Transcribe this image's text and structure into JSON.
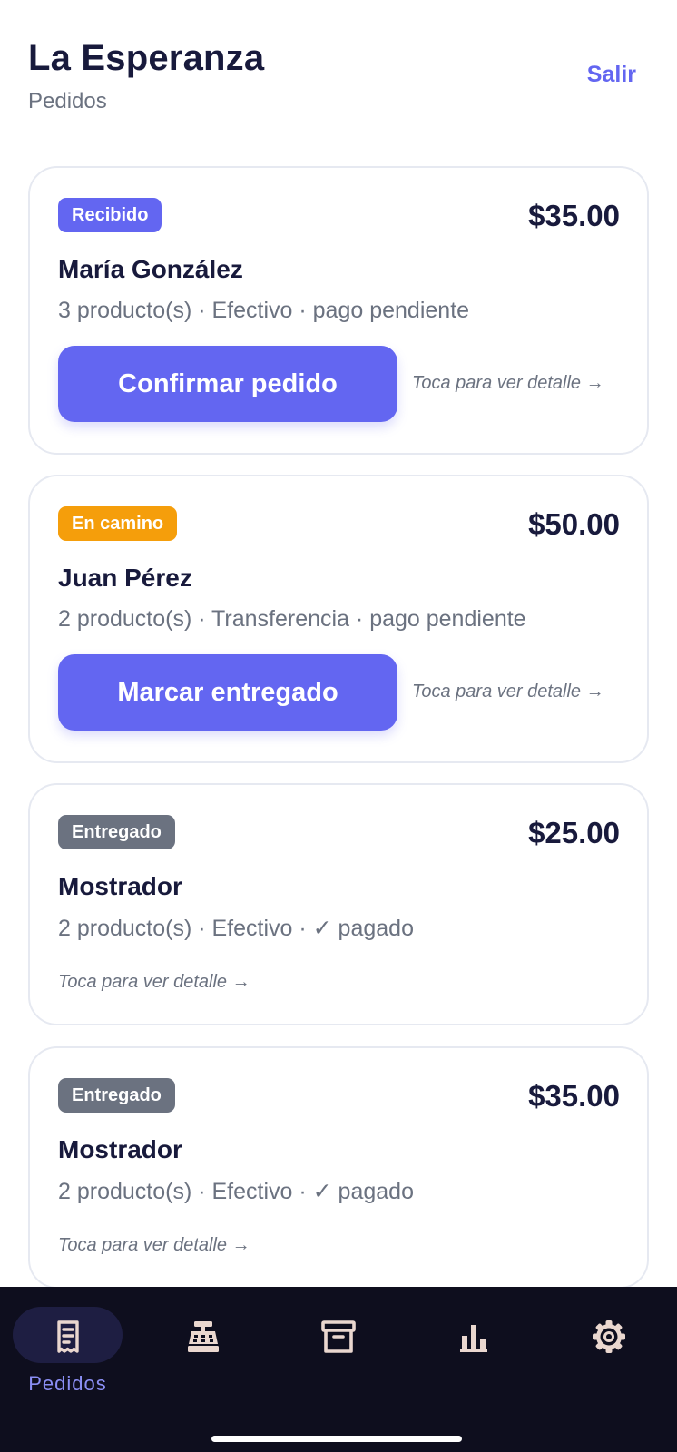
{
  "header": {
    "title": "La Esperanza",
    "subtitle": "Pedidos",
    "logout_label": "Salir"
  },
  "orders": [
    {
      "status": "Recibido",
      "status_color": "#6366f1",
      "total": "$35.00",
      "customer": "María González",
      "summary": "3 producto(s) · Efectivo · pago pendiente",
      "action_label": "Confirmar pedido",
      "hint": "Toca para ver detalle →"
    },
    {
      "status": "En camino",
      "status_color": "#f59e0b",
      "total": "$50.00",
      "customer": "Juan Pérez",
      "summary": "2 producto(s) · Transferencia · pago pendiente",
      "action_label": "Marcar entregado",
      "hint": "Toca para ver detalle →"
    },
    {
      "status": "Entregado",
      "status_color": "#6b7280",
      "total": "$25.00",
      "customer": "Mostrador",
      "summary": "2 producto(s) · Efectivo · ✓ pagado",
      "hint": "Toca para ver detalle →"
    },
    {
      "status": "Entregado",
      "status_color": "#6b7280",
      "total": "$35.00",
      "customer": "Mostrador",
      "summary": "2 producto(s) · Efectivo · ✓ pagado",
      "hint": "Toca para ver detalle →"
    }
  ],
  "bottom_nav": {
    "items": [
      {
        "icon": "receipt-icon",
        "label": "Pedidos",
        "active": true
      },
      {
        "icon": "cash-register-icon",
        "active": false
      },
      {
        "icon": "archive-box-icon",
        "active": false
      },
      {
        "icon": "bar-chart-icon",
        "active": false
      },
      {
        "icon": "gear-icon",
        "active": false
      }
    ]
  },
  "colors": {
    "accent": "#6366f1",
    "nav_background": "#0e0e1e",
    "nav_icon": "#ead7cf"
  }
}
